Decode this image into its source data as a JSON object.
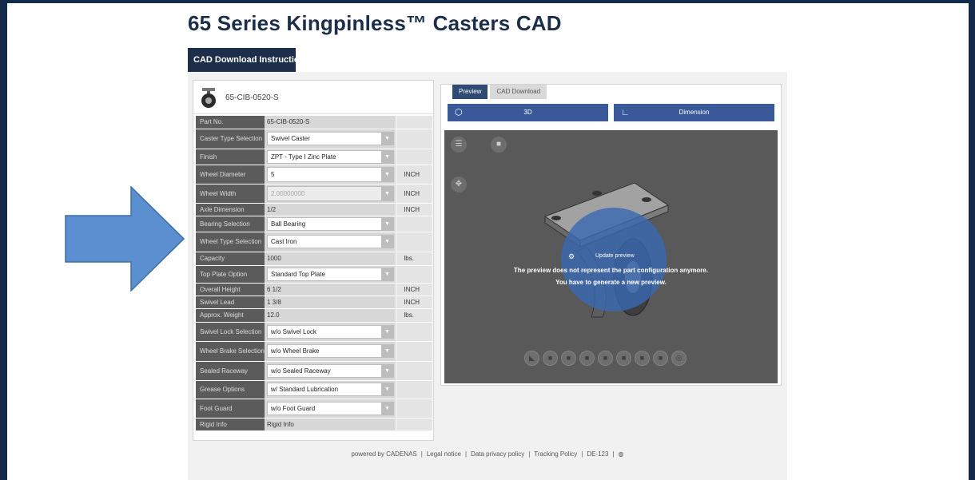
{
  "title": "65 Series Kingpinless™ Casters CAD",
  "instructions_tab": "CAD Download Instructions",
  "part_code": "65-CIB-0520-S",
  "attributes": [
    {
      "label": "Part No.",
      "value": "65-CIB-0520-S",
      "unit": "",
      "type": "text"
    },
    {
      "label": "Caster Type Selection",
      "value": "Swivel Caster",
      "unit": "",
      "type": "select"
    },
    {
      "label": "Finish",
      "value": "ZPT - Type I Zinc Plate",
      "unit": "",
      "type": "select"
    },
    {
      "label": "Wheel Diameter",
      "value": "5",
      "unit": "INCH",
      "type": "select"
    },
    {
      "label": "Wheel Width",
      "value": "2.00000000",
      "unit": "INCH",
      "type": "select-disabled"
    },
    {
      "label": "Axle Dimension",
      "value": "1/2",
      "unit": "INCH",
      "type": "text"
    },
    {
      "label": "Bearing Selection",
      "value": "Ball Bearing",
      "unit": "",
      "type": "select"
    },
    {
      "label": "Wheel Type Selection",
      "value": "Cast Iron",
      "unit": "",
      "type": "select"
    },
    {
      "label": "Capacity",
      "value": "1000",
      "unit": "lbs.",
      "type": "text"
    },
    {
      "label": "Top Plate Option",
      "value": "Standard Top Plate",
      "unit": "",
      "type": "select"
    },
    {
      "label": "Overall Height",
      "value": "6 1/2",
      "unit": "INCH",
      "type": "text"
    },
    {
      "label": "Swivel Lead",
      "value": "1 3/8",
      "unit": "INCH",
      "type": "text"
    },
    {
      "label": "Approx. Weight",
      "value": "12.0",
      "unit": "lbs.",
      "type": "text"
    },
    {
      "label": "Swivel Lock Selection",
      "value": "w/o Swivel Lock",
      "unit": "",
      "type": "select"
    },
    {
      "label": "Wheel Brake Selection",
      "value": "w/o Wheel Brake",
      "unit": "",
      "type": "select"
    },
    {
      "label": "Sealed Raceway",
      "value": "w/o Sealed Raceway",
      "unit": "",
      "type": "select"
    },
    {
      "label": "Grease Options",
      "value": "w/ Standard Lubrication",
      "unit": "",
      "type": "select"
    },
    {
      "label": "Foot Guard",
      "value": "w/o Foot Guard",
      "unit": "",
      "type": "select"
    },
    {
      "label": "Rigid Info",
      "value": "Rigid Info",
      "unit": "",
      "type": "text"
    }
  ],
  "right_tabs": {
    "preview": "Preview",
    "cad_download": "CAD Download"
  },
  "view_buttons": {
    "three_d": "3D",
    "dimension": "Dimension"
  },
  "viewer": {
    "update_label": "Update preview",
    "message_line1": "The preview does not represent the part configuration anymore.",
    "message_line2": "You have to generate a new preview."
  },
  "footer": {
    "powered": "powered by CADENAS",
    "legal": "Legal notice",
    "privacy": "Data privacy policy",
    "tracking": "Tracking Policy",
    "region": "DE-123"
  },
  "colors": {
    "background": "#142a4b",
    "title": "#1c2e4a",
    "accent_button": "#3a5998",
    "arrow": "#5b8fd0",
    "viewer_bg": "#595959"
  }
}
